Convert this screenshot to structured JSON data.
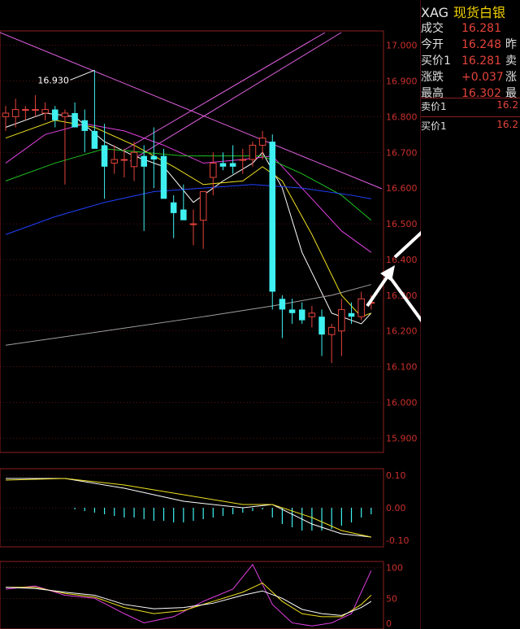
{
  "quote": {
    "code": "XAG",
    "name": "现货白银",
    "rows": [
      {
        "label": "成交",
        "value": "16.281",
        "extra": ""
      },
      {
        "label": "今开",
        "value": "16.248",
        "extra": "昨"
      },
      {
        "label": "买价1",
        "value": "16.281",
        "extra": "卖"
      },
      {
        "label": "涨跌",
        "value": "+0.037",
        "extra": "涨"
      },
      {
        "label": "最高",
        "value": "16.302",
        "extra": "最"
      }
    ],
    "orderbook": [
      {
        "label": "卖价1",
        "value": "16.2"
      },
      {
        "label": "买价1",
        "value": "16.2"
      }
    ]
  },
  "colors": {
    "up": "#e5433b",
    "down": "#3ff0f0",
    "grid": "#8b1f1f",
    "ma5": "#ffffff",
    "ma10": "#f0e020",
    "ma20": "#e040e0",
    "ma30": "#20c020",
    "ma60": "#2040ff",
    "ma120": "#a0a0a0",
    "trend": "#e060e0",
    "arrow": "#ffffff"
  },
  "chart_data": [
    {
      "type": "candlestick",
      "ylim": [
        15.86,
        17.04
      ],
      "y_ticks": [
        "17.000",
        "16.900",
        "16.800",
        "16.700",
        "16.600",
        "16.500",
        "16.400",
        "16.300",
        "16.200",
        "16.100",
        "16.000",
        "15.900"
      ],
      "annotations": [
        {
          "text": "16.930",
          "x_index": 9,
          "value": 16.93
        }
      ],
      "candles": [
        {
          "o": 16.8,
          "h": 16.83,
          "l": 16.76,
          "c": 16.81
        },
        {
          "o": 16.8,
          "h": 16.85,
          "l": 16.77,
          "c": 16.82
        },
        {
          "o": 16.82,
          "h": 16.83,
          "l": 16.79,
          "c": 16.82
        },
        {
          "o": 16.82,
          "h": 16.86,
          "l": 16.8,
          "c": 16.82
        },
        {
          "o": 16.81,
          "h": 16.84,
          "l": 16.79,
          "c": 16.82
        },
        {
          "o": 16.82,
          "h": 16.83,
          "l": 16.77,
          "c": 16.79
        },
        {
          "o": 16.8,
          "h": 16.82,
          "l": 16.61,
          "c": 16.81
        },
        {
          "o": 16.81,
          "h": 16.84,
          "l": 16.77,
          "c": 16.77
        },
        {
          "o": 16.79,
          "h": 16.82,
          "l": 16.7,
          "c": 16.76
        },
        {
          "o": 16.76,
          "h": 16.93,
          "l": 16.72,
          "c": 16.71
        },
        {
          "o": 16.72,
          "h": 16.78,
          "l": 16.57,
          "c": 16.66
        },
        {
          "o": 16.67,
          "h": 16.72,
          "l": 16.64,
          "c": 16.68
        },
        {
          "o": 16.68,
          "h": 16.71,
          "l": 16.63,
          "c": 16.68
        },
        {
          "o": 16.66,
          "h": 16.73,
          "l": 16.62,
          "c": 16.7
        },
        {
          "o": 16.69,
          "h": 16.72,
          "l": 16.48,
          "c": 16.66
        },
        {
          "o": 16.69,
          "h": 16.77,
          "l": 16.6,
          "c": 16.68
        },
        {
          "o": 16.69,
          "h": 16.71,
          "l": 16.63,
          "c": 16.57
        },
        {
          "o": 16.56,
          "h": 16.58,
          "l": 16.46,
          "c": 16.53
        },
        {
          "o": 16.54,
          "h": 16.61,
          "l": 16.52,
          "c": 16.51
        },
        {
          "o": 16.5,
          "h": 16.54,
          "l": 16.44,
          "c": 16.5
        },
        {
          "o": 16.51,
          "h": 16.58,
          "l": 16.43,
          "c": 16.59
        },
        {
          "o": 16.63,
          "h": 16.7,
          "l": 16.58,
          "c": 16.67
        },
        {
          "o": 16.67,
          "h": 16.7,
          "l": 16.65,
          "c": 16.66
        },
        {
          "o": 16.67,
          "h": 16.72,
          "l": 16.64,
          "c": 16.66
        },
        {
          "o": 16.68,
          "h": 16.71,
          "l": 16.64,
          "c": 16.68
        },
        {
          "o": 16.68,
          "h": 16.73,
          "l": 16.66,
          "c": 16.72
        },
        {
          "o": 16.72,
          "h": 16.76,
          "l": 16.68,
          "c": 16.74
        },
        {
          "o": 16.73,
          "h": 16.75,
          "l": 16.26,
          "c": 16.31
        },
        {
          "o": 16.29,
          "h": 16.3,
          "l": 16.18,
          "c": 16.26
        },
        {
          "o": 16.26,
          "h": 16.29,
          "l": 16.22,
          "c": 16.25
        },
        {
          "o": 16.26,
          "h": 16.28,
          "l": 16.22,
          "c": 16.23
        },
        {
          "o": 16.24,
          "h": 16.27,
          "l": 16.21,
          "c": 16.25
        },
        {
          "o": 16.24,
          "h": 16.26,
          "l": 16.13,
          "c": 16.19
        },
        {
          "o": 16.19,
          "h": 16.22,
          "l": 16.11,
          "c": 16.21
        },
        {
          "o": 16.2,
          "h": 16.29,
          "l": 16.13,
          "c": 16.26
        },
        {
          "o": 16.25,
          "h": 16.28,
          "l": 16.22,
          "c": 16.24
        },
        {
          "o": 16.24,
          "h": 16.31,
          "l": 16.23,
          "c": 16.29
        },
        {
          "o": 16.28,
          "h": 16.3,
          "l": 16.26,
          "c": 16.28
        }
      ],
      "ma_lines": [
        {
          "color_key": "ma5",
          "values": [
            [
              0,
              16.77
            ],
            [
              4,
              16.81
            ],
            [
              7,
              16.8
            ],
            [
              10,
              16.73
            ],
            [
              13,
              16.69
            ],
            [
              16,
              16.66
            ],
            [
              19,
              16.56
            ],
            [
              22,
              16.62
            ],
            [
              25,
              16.67
            ],
            [
              26,
              16.7
            ],
            [
              28,
              16.6
            ],
            [
              30,
              16.42
            ],
            [
              33,
              16.25
            ],
            [
              36,
              16.22
            ],
            [
              37,
              16.25
            ]
          ]
        },
        {
          "color_key": "ma10",
          "values": [
            [
              0,
              16.74
            ],
            [
              5,
              16.79
            ],
            [
              9,
              16.77
            ],
            [
              13,
              16.72
            ],
            [
              17,
              16.66
            ],
            [
              20,
              16.61
            ],
            [
              24,
              16.62
            ],
            [
              26,
              16.66
            ],
            [
              28,
              16.62
            ],
            [
              31,
              16.47
            ],
            [
              34,
              16.3
            ],
            [
              36,
              16.24
            ],
            [
              37,
              16.25
            ]
          ]
        },
        {
          "color_key": "ma20",
          "values": [
            [
              0,
              16.67
            ],
            [
              4,
              16.75
            ],
            [
              8,
              16.78
            ],
            [
              12,
              16.76
            ],
            [
              16,
              16.72
            ],
            [
              20,
              16.67
            ],
            [
              24,
              16.68
            ],
            [
              27,
              16.69
            ],
            [
              30,
              16.6
            ],
            [
              34,
              16.48
            ],
            [
              37,
              16.42
            ]
          ]
        },
        {
          "color_key": "ma30",
          "values": [
            [
              0,
              16.62
            ],
            [
              5,
              16.67
            ],
            [
              10,
              16.71
            ],
            [
              14,
              16.7
            ],
            [
              18,
              16.69
            ],
            [
              22,
              16.69
            ],
            [
              26,
              16.69
            ],
            [
              30,
              16.64
            ],
            [
              34,
              16.58
            ],
            [
              37,
              16.51
            ]
          ]
        },
        {
          "color_key": "ma60",
          "values": [
            [
              0,
              16.47
            ],
            [
              5,
              16.52
            ],
            [
              10,
              16.56
            ],
            [
              15,
              16.59
            ],
            [
              20,
              16.6
            ],
            [
              25,
              16.61
            ],
            [
              30,
              16.6
            ],
            [
              35,
              16.58
            ],
            [
              37,
              16.57
            ]
          ]
        },
        {
          "color_key": "ma120",
          "values": [
            [
              0,
              16.16
            ],
            [
              10,
              16.2
            ],
            [
              20,
              16.24
            ],
            [
              27,
              16.27
            ],
            [
              33,
              16.3
            ],
            [
              37,
              16.33
            ]
          ]
        }
      ]
    },
    {
      "type": "bar",
      "ylim": [
        -0.12,
        0.12
      ],
      "y_ticks": [
        "0.10",
        "0.00",
        "-0.10"
      ],
      "values": [
        0.0,
        0.0,
        0.0,
        0.0,
        0.0,
        0.0,
        0.0,
        -0.005,
        -0.01,
        -0.015,
        -0.02,
        -0.025,
        -0.03,
        -0.03,
        -0.035,
        -0.04,
        -0.04,
        -0.045,
        -0.045,
        -0.04,
        -0.035,
        -0.03,
        -0.025,
        -0.02,
        -0.015,
        -0.01,
        -0.005,
        -0.03,
        -0.05,
        -0.06,
        -0.07,
        -0.07,
        -0.07,
        -0.065,
        -0.055,
        -0.045,
        -0.03,
        -0.02
      ],
      "lines": [
        {
          "color_key": "ma5",
          "values": [
            [
              0,
              0.09
            ],
            [
              6,
              0.09
            ],
            [
              12,
              0.06
            ],
            [
              18,
              0.02
            ],
            [
              24,
              0.0
            ],
            [
              27,
              0.01
            ],
            [
              31,
              -0.05
            ],
            [
              34,
              -0.08
            ],
            [
              37,
              -0.09
            ]
          ]
        },
        {
          "color_key": "ma10",
          "values": [
            [
              0,
              0.085
            ],
            [
              6,
              0.09
            ],
            [
              12,
              0.07
            ],
            [
              18,
              0.04
            ],
            [
              24,
              0.01
            ],
            [
              27,
              0.01
            ],
            [
              31,
              -0.03
            ],
            [
              34,
              -0.07
            ],
            [
              37,
              -0.09
            ]
          ]
        }
      ]
    },
    {
      "type": "line",
      "ylim": [
        0,
        110
      ],
      "y_ticks": [
        "100",
        "50",
        "0"
      ],
      "lines": [
        {
          "color_key": "ma20",
          "values": [
            [
              0,
              65
            ],
            [
              3,
              70
            ],
            [
              6,
              55
            ],
            [
              9,
              50
            ],
            [
              12,
              25
            ],
            [
              14,
              10
            ],
            [
              17,
              20
            ],
            [
              20,
              45
            ],
            [
              23,
              65
            ],
            [
              25,
              105
            ],
            [
              27,
              40
            ],
            [
              29,
              10
            ],
            [
              31,
              5
            ],
            [
              33,
              10
            ],
            [
              35,
              25
            ],
            [
              36,
              60
            ],
            [
              37,
              95
            ]
          ]
        },
        {
          "color_key": "ma10",
          "values": [
            [
              0,
              68
            ],
            [
              3,
              68
            ],
            [
              6,
              58
            ],
            [
              9,
              52
            ],
            [
              12,
              35
            ],
            [
              15,
              25
            ],
            [
              18,
              30
            ],
            [
              21,
              45
            ],
            [
              24,
              60
            ],
            [
              26,
              75
            ],
            [
              28,
              45
            ],
            [
              30,
              25
            ],
            [
              32,
              20
            ],
            [
              34,
              20
            ],
            [
              36,
              40
            ],
            [
              37,
              55
            ]
          ]
        },
        {
          "color_key": "ma5",
          "values": [
            [
              0,
              68
            ],
            [
              3,
              66
            ],
            [
              6,
              60
            ],
            [
              9,
              55
            ],
            [
              12,
              40
            ],
            [
              15,
              33
            ],
            [
              18,
              35
            ],
            [
              21,
              42
            ],
            [
              24,
              55
            ],
            [
              26,
              62
            ],
            [
              28,
              50
            ],
            [
              30,
              32
            ],
            [
              32,
              25
            ],
            [
              34,
              22
            ],
            [
              36,
              35
            ],
            [
              37,
              45
            ]
          ]
        }
      ]
    }
  ]
}
